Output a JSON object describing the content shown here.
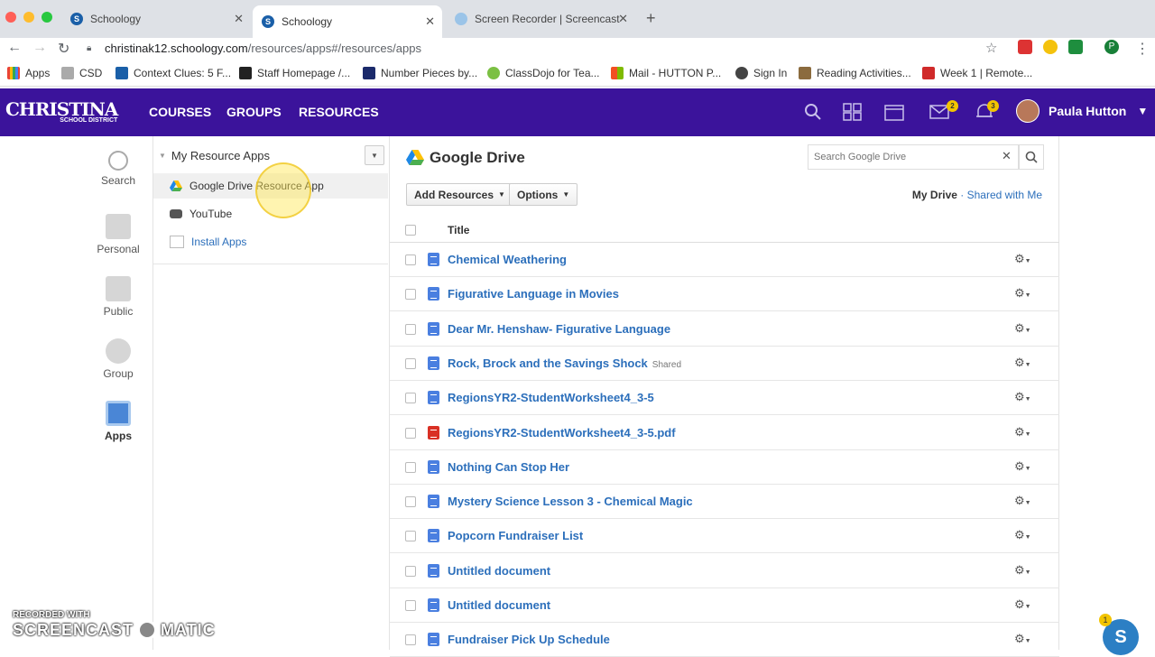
{
  "browser": {
    "tabs": [
      {
        "title": "Schoology",
        "favicon": "schoology-icon"
      },
      {
        "title": "Schoology",
        "favicon": "schoology-icon"
      },
      {
        "title": "Screen Recorder | Screencast",
        "favicon": "screencast-icon"
      }
    ],
    "url_host": "christinak12.schoology.com",
    "url_path": "/resources/apps#/resources/apps",
    "profile_initial": "P",
    "bookmarks": [
      "Apps",
      "CSD",
      "Context Clues: 5 F...",
      "Staff Homepage /...",
      "Number Pieces by...",
      "ClassDojo for Tea...",
      "Mail - HUTTON P...",
      "Sign In",
      "Reading Activities...",
      "Week 1 | Remote..."
    ]
  },
  "header": {
    "logo_main": "CHRISTINA",
    "logo_sub": "SCHOOL DISTRICT",
    "nav": [
      "COURSES",
      "GROUPS",
      "RESOURCES"
    ],
    "messages_badge": "2",
    "notifications_badge": "3",
    "user_name": "Paula Hutton",
    "brand_color": "#3b139b"
  },
  "rail": {
    "items": [
      "Search",
      "Personal",
      "Public",
      "Group",
      "Apps"
    ]
  },
  "apps_panel": {
    "heading": "My Resource Apps",
    "items": [
      "Google Drive Resource App",
      "YouTube",
      "Install Apps"
    ]
  },
  "main": {
    "title": "Google Drive",
    "search_placeholder": "Search Google Drive",
    "add_resources": "Add Resources",
    "options": "Options",
    "my_drive": "My Drive",
    "separator": "·",
    "shared_with_me": "Shared with Me",
    "column_title": "Title",
    "rows": [
      {
        "name": "Chemical Weathering",
        "type": "gdoc",
        "tag": ""
      },
      {
        "name": "Figurative Language in Movies",
        "type": "gdoc",
        "tag": ""
      },
      {
        "name": "Dear Mr. Henshaw- Figurative Language",
        "type": "gdoc",
        "tag": ""
      },
      {
        "name": "Rock, Brock and the Savings Shock",
        "type": "gdoc",
        "tag": "Shared"
      },
      {
        "name": "RegionsYR2-StudentWorksheet4_3-5",
        "type": "gdoc",
        "tag": ""
      },
      {
        "name": "RegionsYR2-StudentWorksheet4_3-5.pdf",
        "type": "pdf",
        "tag": ""
      },
      {
        "name": "Nothing Can Stop Her",
        "type": "gdoc",
        "tag": ""
      },
      {
        "name": "Mystery Science Lesson 3 - Chemical Magic",
        "type": "gdoc",
        "tag": ""
      },
      {
        "name": "Popcorn Fundraiser List",
        "type": "gdoc",
        "tag": ""
      },
      {
        "name": "Untitled document",
        "type": "gdoc",
        "tag": ""
      },
      {
        "name": "Untitled document",
        "type": "gdoc",
        "tag": ""
      },
      {
        "name": "Fundraiser Pick Up Schedule",
        "type": "gdoc",
        "tag": ""
      }
    ]
  },
  "overlay": {
    "recorded_with": "RECORDED WITH",
    "brand_left": "SCREENCAST",
    "brand_right": "MATIC",
    "fab_letter": "S",
    "fab_badge": "1"
  }
}
